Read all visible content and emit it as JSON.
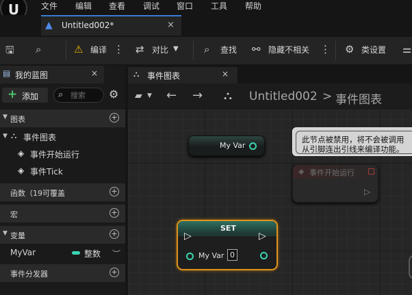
{
  "app": {
    "logo": "U"
  },
  "menu": [
    "文件",
    "编辑",
    "查看",
    "调试",
    "窗口",
    "工具",
    "帮助"
  ],
  "doc_tab": {
    "title": "Untitled002*",
    "close": "×"
  },
  "toolbar": {
    "compile": "编译",
    "diff": "对比",
    "find": "查找",
    "hide_unrelated": "隐藏不相关",
    "class_settings": "类设置"
  },
  "left_panel": {
    "tab_title": "我的蓝图",
    "close": "×",
    "add_label": "添加",
    "search_placeholder": "搜索",
    "sections": {
      "graphs": "图表",
      "functions": "函数（19可覆盖",
      "macros": "宏",
      "variables": "变量",
      "dispatchers": "事件分发器"
    },
    "event_graph": "事件图表",
    "event_begin_play": "事件开始运行",
    "event_tick": "事件Tick",
    "variable": {
      "name": "MyVar",
      "type": "整数"
    }
  },
  "graph": {
    "tab_title": "事件图表",
    "close": "×",
    "breadcrumb_root": "Untitled002",
    "breadcrumb_sep": ">",
    "breadcrumb_leaf": "事件图表",
    "get_node_label": "My Var",
    "tooltip_line1": "此节点被禁用，将不会被调用",
    "tooltip_line2": "从引脚连出引线来编译功能。",
    "disabled_node_label": "事件开始运行",
    "set_node": {
      "title": "SET",
      "var_label": "My Var",
      "value": "0"
    }
  },
  "colors": {
    "accent": "#3a7bd5",
    "selected_border": "#e0941c",
    "int_pin": "#3ad5b0"
  }
}
